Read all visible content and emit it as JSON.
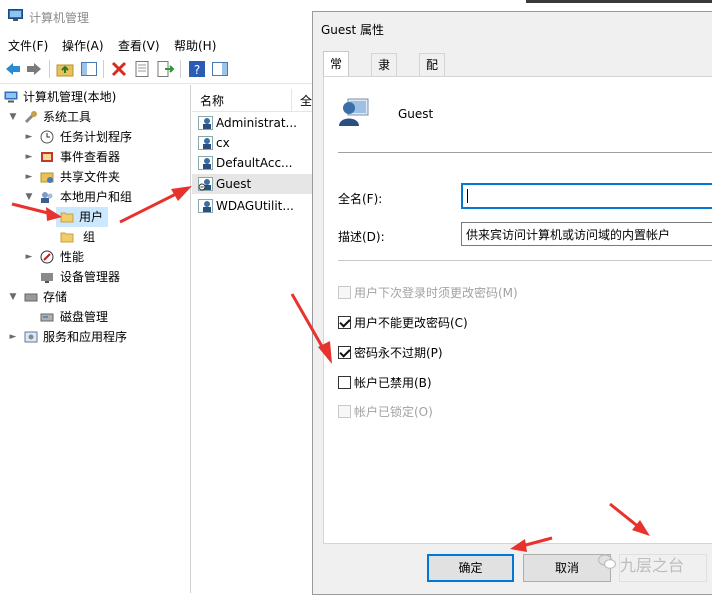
{
  "window": {
    "title": "计算机管理",
    "menu": [
      "文件(F)",
      "操作(A)",
      "查看(V)",
      "帮助(H)"
    ]
  },
  "tree": {
    "root": "计算机管理(本地)",
    "items": [
      {
        "label": "系统工具",
        "icon": "tools-icon"
      },
      {
        "label": "任务计划程序",
        "icon": "clock-icon"
      },
      {
        "label": "事件查看器",
        "icon": "event-viewer-icon"
      },
      {
        "label": "共享文件夹",
        "icon": "shared-folder-icon"
      },
      {
        "label": "本地用户和组",
        "icon": "users-groups-icon"
      },
      {
        "label": "用户",
        "icon": "folder-icon"
      },
      {
        "label": "组",
        "icon": "folder-icon"
      },
      {
        "label": "性能",
        "icon": "performance-icon"
      },
      {
        "label": "设备管理器",
        "icon": "device-manager-icon"
      },
      {
        "label": "存储",
        "icon": "storage-icon"
      },
      {
        "label": "磁盘管理",
        "icon": "disk-icon"
      },
      {
        "label": "服务和应用程序",
        "icon": "services-icon"
      }
    ]
  },
  "list": {
    "col_name": "名称",
    "col_full": "全",
    "rows": [
      "Administrat...",
      "cx",
      "DefaultAcc...",
      "Guest",
      "WDAGUtilit..."
    ]
  },
  "dialog": {
    "title": "Guest 属性",
    "tabs": [
      "常规",
      "隶属于",
      "配置文件"
    ],
    "user_name": "Guest",
    "fullname_label": "全名(F):",
    "fullname_value": "",
    "desc_label": "描述(D):",
    "desc_value": "供来宾访问计算机或访问域的内置帐户",
    "checkboxes": [
      {
        "label": "用户下次登录时须更改密码(M)",
        "checked": false,
        "enabled": false
      },
      {
        "label": "用户不能更改密码(C)",
        "checked": true,
        "enabled": true
      },
      {
        "label": "密码永不过期(P)",
        "checked": true,
        "enabled": true
      },
      {
        "label": "帐户已禁用(B)",
        "checked": false,
        "enabled": true
      },
      {
        "label": "帐户已锁定(O)",
        "checked": false,
        "enabled": false
      }
    ],
    "ok_label": "确定",
    "cancel_label": "取消"
  },
  "watermark": {
    "text": "九层之台"
  },
  "colors": {
    "accent": "#0078d7",
    "annotation": "#e8322d",
    "selection": "#cce8ff"
  }
}
